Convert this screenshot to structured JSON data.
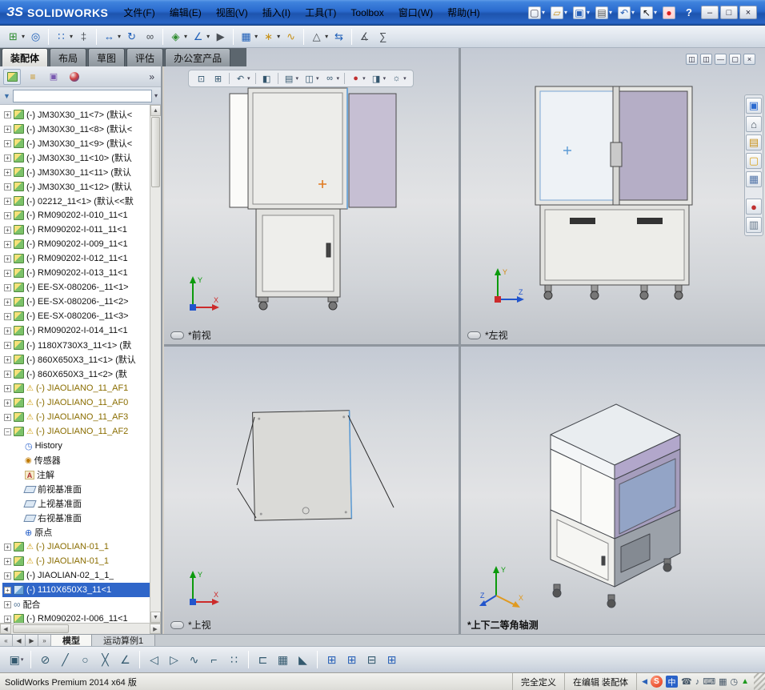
{
  "titlebar": {
    "logo_mark": "ЗS",
    "logo_text": "SOLIDWORKS",
    "menus": [
      "文件(F)",
      "编辑(E)",
      "视图(V)",
      "插入(I)",
      "工具(T)",
      "Toolbox",
      "窗口(W)",
      "帮助(H)"
    ],
    "help_label": "?",
    "window_buttons": {
      "minimize": "–",
      "restore": "□",
      "close": "×"
    }
  },
  "quickbar": {
    "items": [
      {
        "name": "new-document",
        "glyph": "▢"
      },
      {
        "name": "open-document",
        "glyph": "▱"
      },
      {
        "name": "save-document",
        "glyph": "▣"
      },
      {
        "name": "print-document",
        "glyph": "▤"
      },
      {
        "name": "undo",
        "glyph": "↶"
      },
      {
        "name": "select-cursor",
        "glyph": "↖"
      },
      {
        "name": "record-indicator",
        "glyph": "●"
      }
    ]
  },
  "toolbar": {
    "items": [
      {
        "name": "insert-components",
        "glyph": "⊞"
      },
      {
        "name": "mate",
        "glyph": "◎"
      },
      {
        "name": "linear-component-pattern",
        "glyph": "∷"
      },
      {
        "name": "smart-fasteners",
        "glyph": "‡"
      },
      {
        "name": "move-component",
        "glyph": "↔"
      },
      {
        "name": "rotate-component",
        "glyph": "↻"
      },
      {
        "name": "show-hidden-components",
        "glyph": "∞"
      },
      {
        "name": "assembly-features",
        "glyph": "◈"
      },
      {
        "name": "reference-geometry",
        "glyph": "∠"
      },
      {
        "name": "new-motion-study",
        "glyph": "▶"
      },
      {
        "name": "bill-of-materials",
        "glyph": "▦"
      },
      {
        "name": "exploded-view",
        "glyph": "∗"
      },
      {
        "name": "explode-line-sketch",
        "glyph": "∿"
      },
      {
        "name": "interference-detection",
        "glyph": "△"
      },
      {
        "name": "clearance-verification",
        "glyph": "⇆"
      },
      {
        "name": "measure",
        "glyph": "∡"
      },
      {
        "name": "mass-properties",
        "glyph": "∑"
      }
    ]
  },
  "command_tabs": {
    "tabs": [
      "装配体",
      "布局",
      "草图",
      "评估",
      "办公室产品"
    ],
    "active": "装配体"
  },
  "panel": {
    "tabs": [
      {
        "name": "featuremanager",
        "glyph": ""
      },
      {
        "name": "propertymanager",
        "glyph": "≡"
      },
      {
        "name": "configurationmanager",
        "glyph": "▣"
      },
      {
        "name": "displaymanager",
        "glyph": ""
      }
    ],
    "expand": "»",
    "filter_value": ""
  },
  "tree": {
    "items": [
      {
        "label": "(-) JM30X30_11<7> (默认<"
      },
      {
        "label": "(-) JM30X30_11<8> (默认<"
      },
      {
        "label": "(-) JM30X30_11<9> (默认<"
      },
      {
        "label": "(-) JM30X30_11<10> (默认"
      },
      {
        "label": "(-) JM30X30_11<11> (默认"
      },
      {
        "label": "(-) JM30X30_11<12> (默认"
      },
      {
        "label": "(-) 02212_11<1> (默认<<默"
      },
      {
        "label": "(-) RM090202-I-010_11<1"
      },
      {
        "label": "(-) RM090202-I-011_11<1"
      },
      {
        "label": "(-) RM090202-I-009_11<1"
      },
      {
        "label": "(-) RM090202-I-012_11<1"
      },
      {
        "label": "(-) RM090202-I-013_11<1"
      },
      {
        "label": "(-) EE-SX-080206-_11<1>"
      },
      {
        "label": "(-) EE-SX-080206-_11<2>"
      },
      {
        "label": "(-) EE-SX-080206-_11<3>"
      },
      {
        "label": "(-) RM090202-I-014_11<1"
      },
      {
        "label": "(-) 1180X730X3_11<1> (默"
      },
      {
        "label": "(-) 860X650X3_11<1> (默认"
      },
      {
        "label": "(-) 860X650X3_11<2> (默"
      },
      {
        "label": "(-) JIAOLIANO_11_AF1"
      },
      {
        "label": "(-) JIAOLIANO_11_AF0"
      },
      {
        "label": "(-) JIAOLIANO_11_AF3"
      },
      {
        "label": "(-) JIAOLIANO_11_AF2"
      },
      {
        "label": "History"
      },
      {
        "label": "传感器"
      },
      {
        "label": "注解"
      },
      {
        "label": "前视基准面"
      },
      {
        "label": "上视基准面"
      },
      {
        "label": "右视基准面"
      },
      {
        "label": "原点"
      },
      {
        "label": "(-) JIAOLIAN-01_1"
      },
      {
        "label": "(-) JIAOLIAN-01_1"
      },
      {
        "label": "(-) JIAOLIAN-02_1_1_"
      },
      {
        "label": "(-) 1110X650X3_11<1"
      },
      {
        "label": "配合"
      },
      {
        "label": "(-) RM090202-I-006_11<1"
      }
    ]
  },
  "hud": {
    "items": [
      {
        "name": "zoom-fit",
        "glyph": "⊡"
      },
      {
        "name": "zoom-area",
        "glyph": "⊞"
      },
      {
        "name": "previous-view",
        "glyph": "↶"
      },
      {
        "name": "section-view",
        "glyph": "◧"
      },
      {
        "name": "view-orientation",
        "glyph": "▤"
      },
      {
        "name": "display-style",
        "glyph": "◫"
      },
      {
        "name": "hide-show-items",
        "glyph": "∞"
      },
      {
        "name": "edit-appearance",
        "glyph": "●"
      },
      {
        "name": "apply-scene",
        "glyph": "◨"
      },
      {
        "name": "view-settings",
        "glyph": "☼"
      }
    ]
  },
  "doc_controls": {
    "items": [
      {
        "name": "doc-tile-left",
        "glyph": "◫"
      },
      {
        "name": "doc-tile-right",
        "glyph": "◫"
      },
      {
        "name": "doc-minimize",
        "glyph": "—"
      },
      {
        "name": "doc-restore",
        "glyph": "▢"
      },
      {
        "name": "doc-close",
        "glyph": "×"
      }
    ]
  },
  "task_pane": {
    "items": [
      {
        "name": "solidworks-resources",
        "glyph": "▣"
      },
      {
        "name": "home",
        "glyph": "⌂"
      },
      {
        "name": "design-library",
        "glyph": "▤"
      },
      {
        "name": "file-explorer",
        "glyph": "▢"
      },
      {
        "name": "view-palette",
        "glyph": "▦"
      },
      {
        "name": "appearances",
        "glyph": "●"
      },
      {
        "name": "custom-properties",
        "glyph": "▥"
      }
    ]
  },
  "viewports": {
    "front": "*前视",
    "left": "*左视",
    "top": "*上视",
    "iso": "*上下二等角轴测"
  },
  "axes": {
    "x": "X",
    "y": "Y",
    "z": "Z"
  },
  "doc_tabs": {
    "nav": [
      "«",
      "◀",
      "▶",
      "»"
    ],
    "tabs": [
      "模型",
      "运动算例1"
    ],
    "active": "模型"
  },
  "sketchbar": {
    "items": [
      {
        "name": "save",
        "glyph": "▣"
      },
      {
        "name": "no-solve",
        "glyph": "⊘"
      },
      {
        "name": "line",
        "glyph": "╱"
      },
      {
        "name": "circle",
        "glyph": "○"
      },
      {
        "name": "delete-entities",
        "glyph": "╳"
      },
      {
        "name": "smart-dimension",
        "glyph": "∠"
      },
      {
        "name": "mirror-left",
        "glyph": "◁"
      },
      {
        "name": "mirror-right",
        "glyph": "▷"
      },
      {
        "name": "spline",
        "glyph": "∿"
      },
      {
        "name": "offset-entities",
        "glyph": "⌐"
      },
      {
        "name": "sketch-pattern",
        "glyph": "∷"
      },
      {
        "name": "trim-entities",
        "glyph": "⊏"
      },
      {
        "name": "linear-pattern",
        "glyph": "▦"
      },
      {
        "name": "chamfer",
        "glyph": "◣"
      },
      {
        "name": "pane-split-left",
        "glyph": "⊞"
      },
      {
        "name": "pane-split-right",
        "glyph": "⊞"
      },
      {
        "name": "pane-remove",
        "glyph": "⊟"
      },
      {
        "name": "pane-grid",
        "glyph": "⊞"
      }
    ]
  },
  "statusbar": {
    "product": "SolidWorks Premium 2014 x64 版",
    "defined": "完全定义",
    "editing": "在编辑 装配体"
  },
  "tray": {
    "expand": "◀",
    "badge": "S",
    "ime": "中",
    "icons": [
      "☎",
      "♪",
      "⌨",
      "▦",
      "◷"
    ],
    "net": "▲"
  },
  "glyphs": {
    "plus": "+",
    "minus": "−",
    "drop": "▾",
    "warn": "⚠",
    "history": "◷",
    "sensor": "◉",
    "note": "A",
    "origin": "⊕",
    "mate": "∞",
    "funnel": "▼",
    "up": "▲",
    "down": "▼",
    "left": "◀",
    "right": "▶"
  },
  "colors": {
    "selection": "#2f66c9",
    "warning_text": "#8a6d00",
    "highlight_edge": "#5b9bd5",
    "accent_orange": "#e07a20",
    "titlebar": "#2a6ace",
    "panel_purple": "#c6bfd3"
  }
}
